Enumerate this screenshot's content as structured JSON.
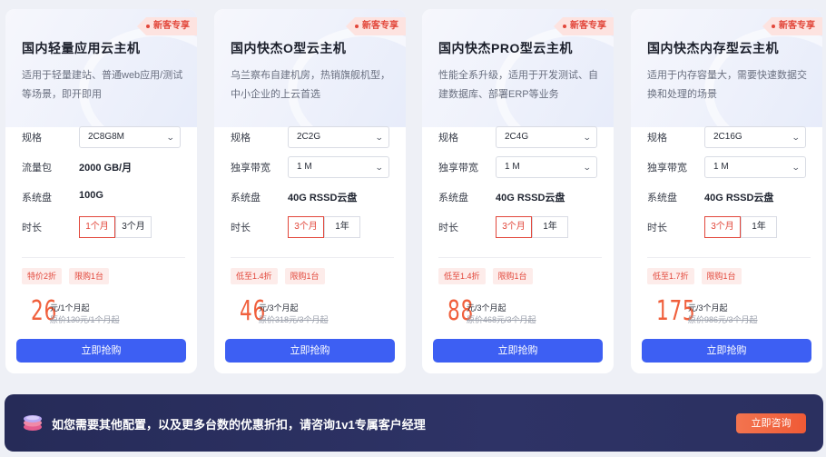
{
  "cards": [
    {
      "badge": "新客专享",
      "title": "国内轻量应用云主机",
      "description": "适用于轻量建站、普通web应用/测试等场景，即开即用",
      "spec_label": "规格",
      "spec_value": "2C8G8M",
      "row2_label": "流量包",
      "row2_value": "2000 GB/月",
      "row2_is_select": false,
      "disk_label": "系统盘",
      "disk_value": "100G",
      "duration_label": "时长",
      "durations": [
        "1个月",
        "3个月"
      ],
      "duration_selected": "1个月",
      "tags": [
        "特价2折",
        "限购1台"
      ],
      "price": "26",
      "price_unit": "元/1个月起",
      "original_price": "原价130元/1个月起",
      "buy_label": "立即抢购"
    },
    {
      "badge": "新客专享",
      "title": "国内快杰O型云主机",
      "description": "乌兰察布自建机房，热销旗舰机型，中小企业的上云首选",
      "spec_label": "规格",
      "spec_value": "2C2G",
      "row2_label": "独享带宽",
      "row2_value": "1 M",
      "row2_is_select": true,
      "disk_label": "系统盘",
      "disk_value": "40G RSSD云盘",
      "duration_label": "时长",
      "durations": [
        "3个月",
        "1年"
      ],
      "duration_selected": "3个月",
      "tags": [
        "低至1.4折",
        "限购1台"
      ],
      "price": "46",
      "price_unit": "元/3个月起",
      "original_price": "原价318元/3个月起",
      "buy_label": "立即抢购"
    },
    {
      "badge": "新客专享",
      "title": "国内快杰PRO型云主机",
      "description": "性能全系升级，适用于开发测试、自建数据库、部署ERP等业务",
      "spec_label": "规格",
      "spec_value": "2C4G",
      "row2_label": "独享带宽",
      "row2_value": "1 M",
      "row2_is_select": true,
      "disk_label": "系统盘",
      "disk_value": "40G RSSD云盘",
      "duration_label": "时长",
      "durations": [
        "3个月",
        "1年"
      ],
      "duration_selected": "3个月",
      "tags": [
        "低至1.4折",
        "限购1台"
      ],
      "price": "88",
      "price_unit": "元/3个月起",
      "original_price": "原价468元/3个月起",
      "buy_label": "立即抢购"
    },
    {
      "badge": "新客专享",
      "title": "国内快杰内存型云主机",
      "description": "适用于内存容量大，需要快速数据交换和处理的场景",
      "spec_label": "规格",
      "spec_value": "2C16G",
      "row2_label": "独享带宽",
      "row2_value": "1 M",
      "row2_is_select": true,
      "disk_label": "系统盘",
      "disk_value": "40G RSSD云盘",
      "duration_label": "时长",
      "durations": [
        "3个月",
        "1年"
      ],
      "duration_selected": "3个月",
      "tags": [
        "低至1.7折",
        "限购1台"
      ],
      "price": "175",
      "price_unit": "元/3个月起",
      "original_price": "原价986元/3个月起",
      "buy_label": "立即抢购"
    }
  ],
  "banner": {
    "text": "如您需要其他配置，以及更多台数的优惠折扣，请咨询1v1专属客户经理",
    "consult_label": "立即咨询",
    "icon": "stack-layers-icon"
  },
  "colors": {
    "accent": "#3d5ff3",
    "price": "#f0603d",
    "badge": "#e2473b",
    "banner_bg": "#2a2f5e"
  }
}
